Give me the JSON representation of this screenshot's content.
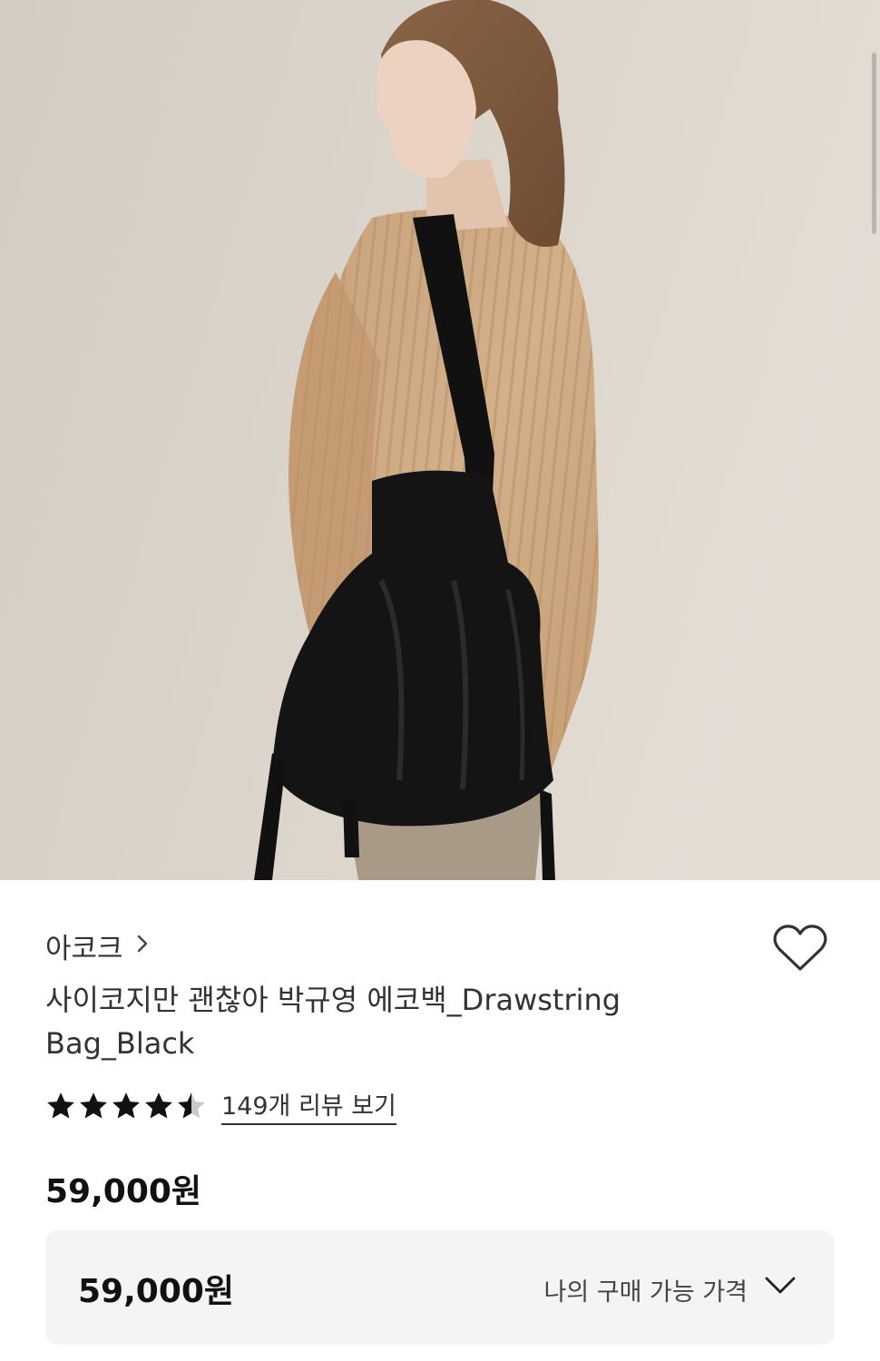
{
  "hero": {
    "image": "product-photo-model-with-black-drawstring-bag"
  },
  "product": {
    "brand": "아코크",
    "brand_chevron_icon": "chevron-right-icon",
    "title": "사이코지만 괜찮아 박규영 에코백_Drawstring Bag_Black",
    "wish_icon": "heart-outline-icon",
    "rating": 4.5,
    "rating_max": 5,
    "review_link": "149개 리뷰 보기",
    "price": "59,000원"
  },
  "price_box": {
    "price": "59,000원",
    "label": "나의 구매 가능 가격",
    "chevron_icon": "chevron-down-icon"
  },
  "colors": {
    "text": "#333333",
    "price": "#111111",
    "price_box_bg": "#f4f4f4",
    "star": "#111111"
  }
}
